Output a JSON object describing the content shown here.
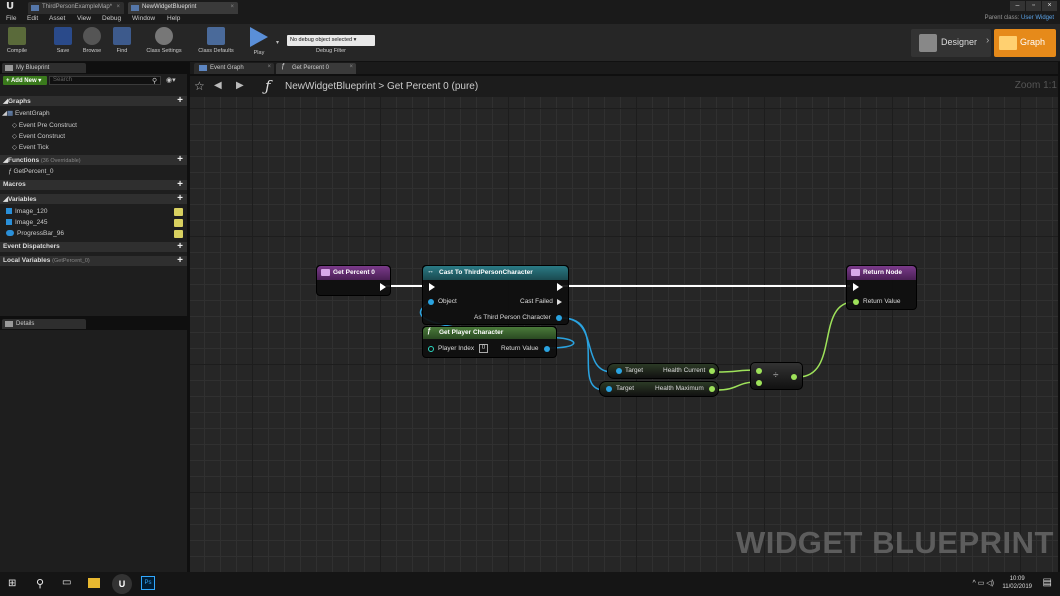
{
  "window": {
    "tabs": [
      {
        "label": "ThirdPersonExampleMap*"
      },
      {
        "label": "NewWidgetBlueprint"
      }
    ],
    "parent_class_label": "Parent class:",
    "parent_class_value": "User Widget"
  },
  "menu": [
    "File",
    "Edit",
    "Asset",
    "View",
    "Debug",
    "Window",
    "Help"
  ],
  "toolbar": {
    "compile": "Compile",
    "save": "Save",
    "browse": "Browse",
    "find": "Find",
    "class_settings": "Class Settings",
    "class_defaults": "Class Defaults",
    "play": "Play",
    "debug_select": "No debug object selected ▾",
    "debug_filter": "Debug Filter",
    "designer": "Designer",
    "graph": "Graph"
  },
  "my_blueprint": {
    "tab": "My Blueprint",
    "add_new": "+ Add New ▾",
    "search_placeholder": "Search",
    "graphs_header": "Graphs",
    "event_graph": "EventGraph",
    "events": [
      "Event Pre Construct",
      "Event Construct",
      "Event Tick"
    ],
    "functions_header": "Functions",
    "functions_sub": "(36 Overridable)",
    "function_item": "GetPercent_0",
    "macros_header": "Macros",
    "variables_header": "Variables",
    "variables": [
      "Image_120",
      "Image_245",
      "ProgressBar_96"
    ],
    "dispatchers_header": "Event Dispatchers",
    "locals_header": "Local Variables",
    "locals_sub": "(GetPercent_0)"
  },
  "details": {
    "tab": "Details"
  },
  "graph_tabs": [
    "Event Graph",
    "Get Percent 0"
  ],
  "breadcrumb": {
    "root": "NewWidgetBlueprint",
    "separator": ">",
    "current": "Get Percent 0 (pure)"
  },
  "zoom": "Zoom 1:1",
  "watermark": "WIDGET BLUEPRINT",
  "nodes": {
    "entry": {
      "title": "Get Percent 0"
    },
    "cast": {
      "title": "Cast To ThirdPersonCharacter",
      "object": "Object",
      "failed": "Cast Failed",
      "as": "As Third Person Character"
    },
    "player": {
      "title": "Get Player Character",
      "index_label": "Player Index",
      "index_value": "0",
      "ret": "Return Value"
    },
    "health_current": {
      "target": "Target",
      "out": "Health Current"
    },
    "health_max": {
      "target": "Target",
      "out": "Health Maximum"
    },
    "divide": {
      "symbol": "÷"
    },
    "ret": {
      "title": "Return Node",
      "value": "Return Value"
    }
  },
  "taskbar": {
    "time": "10:09",
    "date": "11/02/2019"
  },
  "colors": {
    "function_entry": "#6a2b7a",
    "cast_head": "#2a6e78",
    "pure_head": "#3e6a2b",
    "object_pin": "#2aa3e0",
    "float_pin": "#9ee25a",
    "graph_button": "#e68a1a"
  }
}
